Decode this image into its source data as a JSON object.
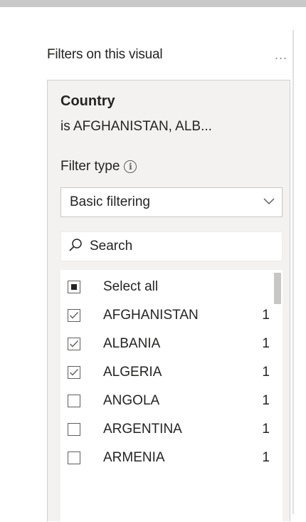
{
  "pane": {
    "title": "Filters on this visual",
    "more_label": "..."
  },
  "filter_card": {
    "field_name": "Country",
    "summary": "is AFGHANISTAN, ALB...",
    "filter_type_label": "Filter type",
    "filter_type_value": "Basic filtering",
    "search_placeholder": "Search",
    "select_all_label": "Select all",
    "items": [
      {
        "label": "AFGHANISTAN",
        "count": "1",
        "checked": true
      },
      {
        "label": "ALBANIA",
        "count": "1",
        "checked": true
      },
      {
        "label": "ALGERIA",
        "count": "1",
        "checked": true
      },
      {
        "label": "ANGOLA",
        "count": "1",
        "checked": false
      },
      {
        "label": "ARGENTINA",
        "count": "1",
        "checked": false
      },
      {
        "label": "ARMENIA",
        "count": "1",
        "checked": false
      }
    ]
  },
  "colors": {
    "text": "#252423",
    "card_bg": "#f3f2f1",
    "border": "#d2d0ce",
    "icon": "#605e5c",
    "topbar": "#c8c8c8"
  }
}
